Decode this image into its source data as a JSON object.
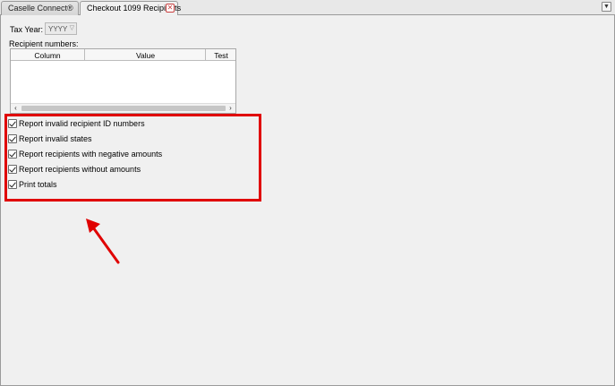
{
  "tabs": [
    {
      "label": "Caselle Connect®",
      "active": false
    },
    {
      "label": "Checkout 1099 Recipients",
      "active": true
    }
  ],
  "form": {
    "tax_year_label": "Tax Year:",
    "tax_year_value": "YYYY",
    "recipient_numbers_label": "Recipient numbers:"
  },
  "grid": {
    "columns": [
      "Column",
      "Value",
      "Test"
    ],
    "rows": []
  },
  "options": [
    {
      "label": "Report invalid recipient ID numbers",
      "checked": true
    },
    {
      "label": "Report invalid states",
      "checked": true
    },
    {
      "label": "Report recipients with negative amounts",
      "checked": true
    },
    {
      "label": "Report recipients without amounts",
      "checked": true
    },
    {
      "label": "Print totals",
      "checked": true
    }
  ],
  "annotation": {
    "highlight_color": "#e00000"
  }
}
